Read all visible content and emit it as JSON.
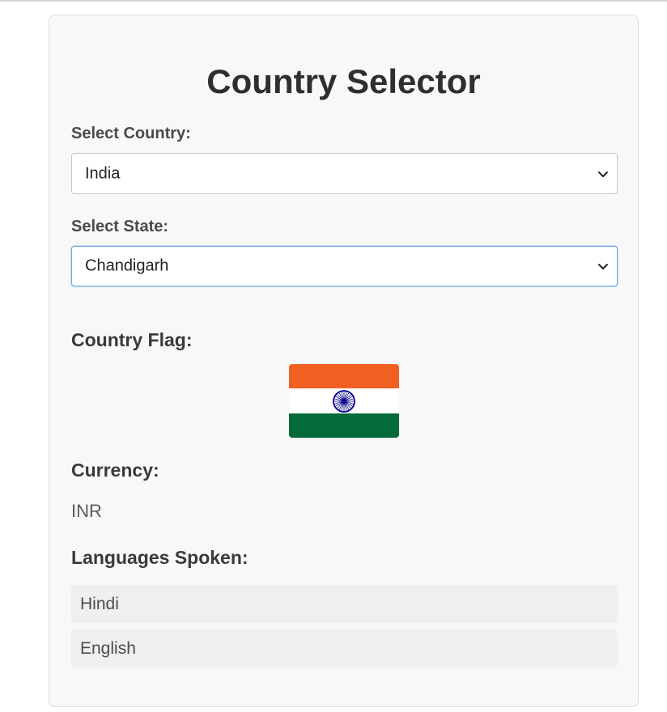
{
  "page": {
    "title": "Country Selector"
  },
  "country_select": {
    "label": "Select Country:",
    "value": "India",
    "icon": "chevron-down-icon"
  },
  "state_select": {
    "label": "Select State:",
    "value": "Chandigarh",
    "icon": "chevron-down-icon"
  },
  "flag_section": {
    "heading": "Country Flag:",
    "colors": {
      "saffron": "#f15f22",
      "white": "#ffffff",
      "green": "#046a38",
      "chakra": "#07038d"
    }
  },
  "currency_section": {
    "heading": "Currency:",
    "value": "INR"
  },
  "languages_section": {
    "heading": "Languages Spoken:",
    "items": [
      "Hindi",
      "English"
    ]
  },
  "colors": {
    "focus_ring": "#6aa8e6",
    "card_background": "#f8f8f8"
  }
}
